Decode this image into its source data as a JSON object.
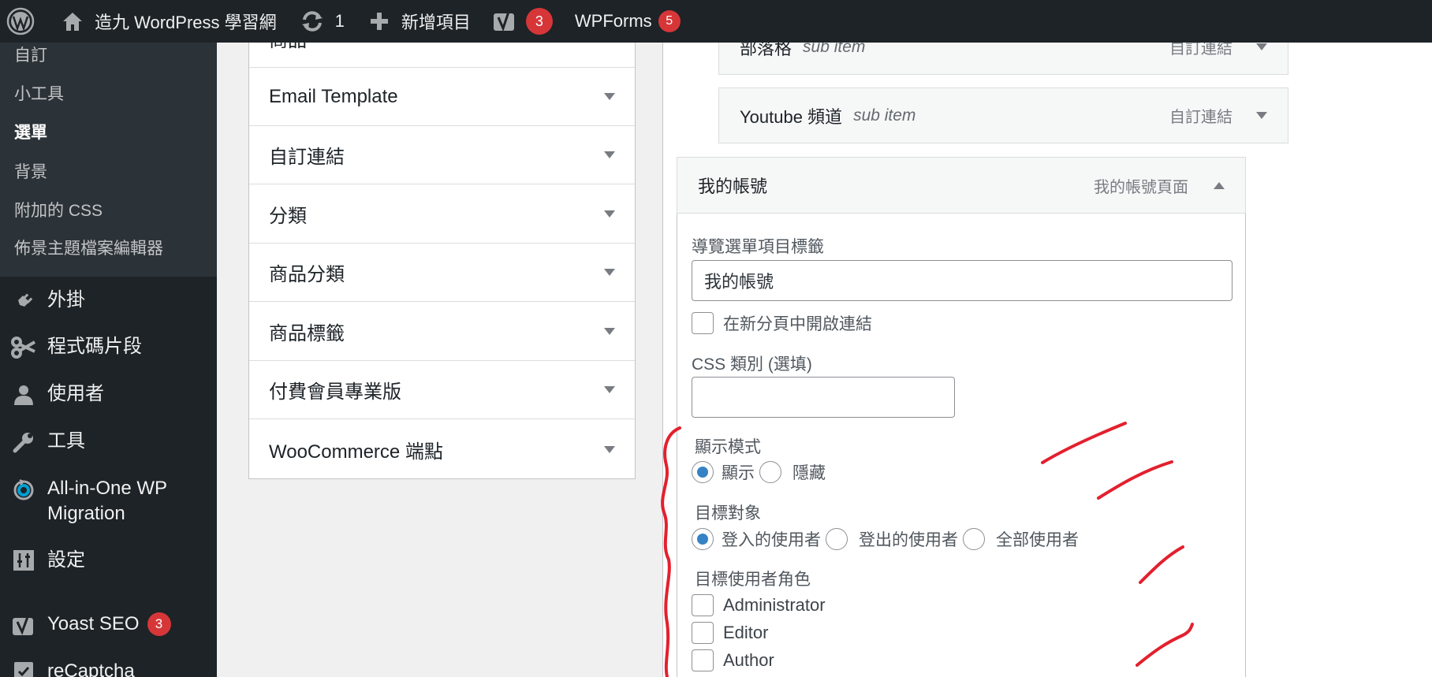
{
  "adminbar": {
    "wp_logo_icon": "wordpress-logo-icon",
    "site_name": "造九 WordPress 學習網",
    "updates_count": "1",
    "new_label": "新增項目",
    "yoast_count": "3",
    "wpforms_label": "WPForms",
    "wpforms_count": "5"
  },
  "sidebar": {
    "submenu": [
      {
        "label": "自訂",
        "current": false
      },
      {
        "label": "小工具",
        "current": false
      },
      {
        "label": "選單",
        "current": true
      },
      {
        "label": "背景",
        "current": false
      },
      {
        "label": "附加的 CSS",
        "current": false
      },
      {
        "label": "佈景主題檔案編輯器",
        "current": false
      }
    ],
    "items": [
      {
        "label": "外掛",
        "icon": "plugin-icon"
      },
      {
        "label": "程式碼片段",
        "icon": "scissors-icon"
      },
      {
        "label": "使用者",
        "icon": "user-icon"
      },
      {
        "label": "工具",
        "icon": "wrench-icon"
      },
      {
        "label": "All-in-One WP Migration",
        "icon": "migration-icon"
      },
      {
        "label": "設定",
        "icon": "settings-sliders-icon"
      },
      {
        "label": "Yoast SEO",
        "icon": "yoast-icon",
        "badge": "3"
      },
      {
        "label": "reCaptcha",
        "icon": "checkbox-icon"
      }
    ]
  },
  "add_items_panel": {
    "sections": [
      {
        "label": "商品"
      },
      {
        "label": "Email Template"
      },
      {
        "label": "自訂連結"
      },
      {
        "label": "分類"
      },
      {
        "label": "商品分類"
      },
      {
        "label": "商品標籤"
      },
      {
        "label": "付費會員專業版"
      },
      {
        "label": "WooCommerce 端點"
      }
    ]
  },
  "menu_structure": {
    "items": [
      {
        "title": "部落格",
        "sub": "sub item",
        "type": "自訂連結"
      },
      {
        "title": "Youtube 頻道",
        "sub": "sub item",
        "type": "自訂連結"
      }
    ],
    "expanded": {
      "title": "我的帳號",
      "type": "我的帳號頁面",
      "nav_label_label": "導覽選單項目標籤",
      "nav_label_value": "我的帳號",
      "new_tab_label": "在新分頁中開啟連結",
      "new_tab_checked": false,
      "css_label": "CSS 類別 (選填)",
      "css_value": "",
      "display_mode_label": "顯示模式",
      "display_mode_options": [
        "顯示",
        "隱藏"
      ],
      "display_mode_selected": "顯示",
      "target_label": "目標對象",
      "target_options": [
        "登入的使用者",
        "登出的使用者",
        "全部使用者"
      ],
      "target_selected": "登入的使用者",
      "roles_label": "目標使用者角色",
      "roles": [
        {
          "label": "Administrator",
          "checked": false
        },
        {
          "label": "Editor",
          "checked": false
        },
        {
          "label": "Author",
          "checked": false
        }
      ]
    }
  },
  "colors": {
    "adminbar_bg": "#1d2327",
    "submenu_bg": "#2c3338",
    "badge": "#d63638",
    "radio_accent": "#3582c4",
    "annotation": "#e3202e"
  }
}
